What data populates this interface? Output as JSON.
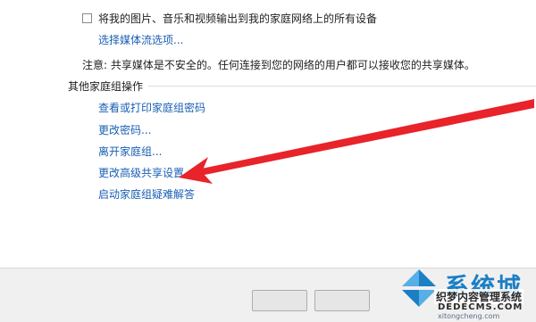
{
  "media_streaming": {
    "checkbox_label": "将我的图片、音乐和视频输出到我的家庭网络上的所有设备",
    "checked": false,
    "options_link": "选择媒体流选项...",
    "note": "注意: 共享媒体是不安全的。任何连接到您的网络的用户都可以接收您的共享媒体。"
  },
  "other_actions": {
    "title": "其他家庭组操作",
    "links": [
      "查看或打印家庭组密码",
      "更改密码...",
      "离开家庭组...",
      "更改高级共享设置...",
      "启动家庭组疑难解答"
    ]
  },
  "annotation": {
    "arrow_color": "#e8232a"
  },
  "watermark": {
    "brand": "系统城",
    "site_name": "织梦内容管理系统",
    "domain": "DEDECMS.COM",
    "url": "xitongcheng.com",
    "brand_color": "#1b7fc4"
  }
}
